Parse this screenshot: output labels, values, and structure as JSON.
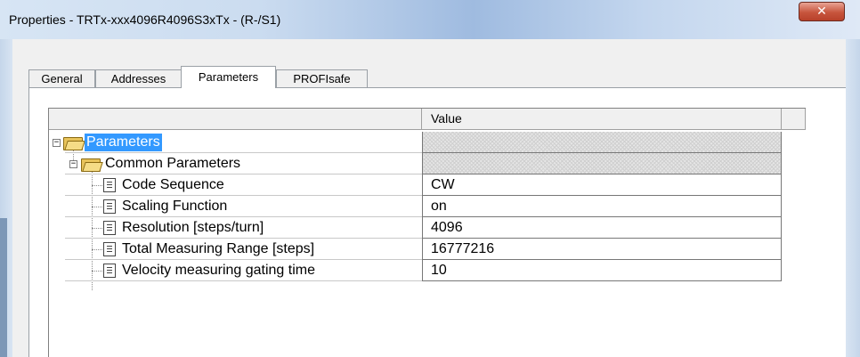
{
  "window": {
    "title": "Properties - TRTx-xxx4096R4096S3xTx - (R-/S1)",
    "close_glyph": "✕"
  },
  "tabs": [
    {
      "label": "General"
    },
    {
      "label": "Addresses"
    },
    {
      "label": "Parameters",
      "active": true
    },
    {
      "label": "PROFIsafe"
    }
  ],
  "grid": {
    "header": {
      "name": "",
      "value": "Value"
    },
    "rows": [
      {
        "label": "Parameters",
        "value": "",
        "type": "folder",
        "selected": true,
        "expanded": true
      },
      {
        "label": "Common Parameters",
        "value": "",
        "type": "folder",
        "expanded": true
      },
      {
        "label": "Code Sequence",
        "value": "CW",
        "type": "item"
      },
      {
        "label": "Scaling Function",
        "value": "on",
        "type": "item"
      },
      {
        "label": "Resolution [steps/turn]",
        "value": "4096",
        "type": "item"
      },
      {
        "label": "Total Measuring Range [steps]",
        "value": "16777216",
        "type": "item"
      },
      {
        "label": "Velocity measuring gating time",
        "value": "10",
        "type": "item"
      }
    ]
  },
  "icons": {
    "folder": "folder-open-icon",
    "item": "parameter-item-icon",
    "collapse": "minus-box-icon"
  },
  "colors": {
    "selection": "#3399ff",
    "close_button": "#c7553d",
    "title_bar": "#cbdcf0"
  }
}
